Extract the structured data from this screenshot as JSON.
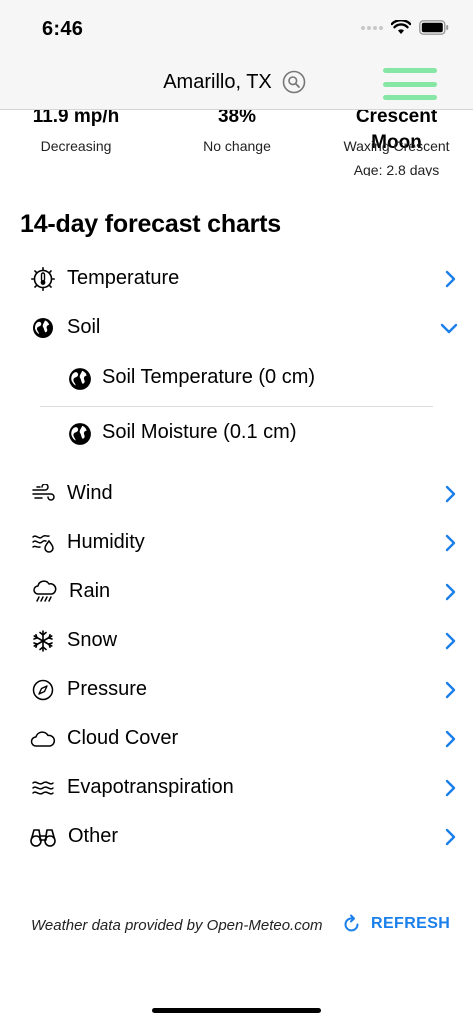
{
  "status": {
    "time": "6:46"
  },
  "nav": {
    "title": "Amarillo, TX"
  },
  "stats": {
    "wind": {
      "value": "11.9 mp/h",
      "trend": "Decreasing"
    },
    "humidity": {
      "value": "38%",
      "trend": "No change"
    },
    "moon": {
      "value": "Crescent Moon",
      "phase": "Waxing Crescent",
      "age": "Age: 2.8 days"
    }
  },
  "section": {
    "title": "14-day forecast charts"
  },
  "categories": [
    {
      "label": "Temperature",
      "icon": "thermometer-sun-icon"
    },
    {
      "label": "Soil",
      "icon": "globe-icon",
      "expanded": true,
      "children": [
        {
          "label": "Soil Temperature (0 cm)",
          "icon": "globe-icon"
        },
        {
          "label": "Soil Moisture (0.1 cm)",
          "icon": "globe-icon"
        }
      ]
    },
    {
      "label": "Wind",
      "icon": "wind-icon"
    },
    {
      "label": "Humidity",
      "icon": "humidity-icon"
    },
    {
      "label": "Rain",
      "icon": "rain-cloud-icon"
    },
    {
      "label": "Snow",
      "icon": "snowflake-icon"
    },
    {
      "label": "Pressure",
      "icon": "compass-icon"
    },
    {
      "label": "Cloud Cover",
      "icon": "cloud-icon"
    },
    {
      "label": "Evapotranspiration",
      "icon": "waves-icon"
    },
    {
      "label": "Other",
      "icon": "binoculars-icon"
    }
  ],
  "footer": {
    "credit": "Weather data provided by Open-Meteo.com",
    "refresh_label": "REFRESH"
  },
  "colors": {
    "accent": "#1a7fea",
    "menu": "#86e6a4"
  }
}
